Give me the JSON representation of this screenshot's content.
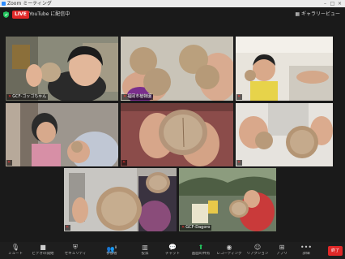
{
  "window": {
    "title": "Zoom ミーティング"
  },
  "topbar": {
    "live_badge": "LIVE",
    "stream_label": "YouTube に配信中",
    "view_label": "ギャラリービュー"
  },
  "participants": [
    {
      "name": "GCF-ゴッゴちゃん",
      "active": true
    },
    {
      "name": "福岡市植物園"
    },
    {
      "name": ""
    },
    {
      "name": ""
    },
    {
      "name": ""
    },
    {
      "name": ""
    },
    {
      "name": ""
    },
    {
      "name": "GCF-Dagoro"
    }
  ],
  "toolbar": {
    "items": [
      {
        "label": "ミュート",
        "icon": "mic-icon"
      },
      {
        "label": "ビデオの開始",
        "icon": "camera-icon"
      },
      {
        "label": "セキュリティ",
        "icon": "shield-icon"
      },
      {
        "label": "参加者",
        "icon": "participants-icon",
        "count": "8"
      },
      {
        "label": "投票",
        "icon": "poll-icon"
      },
      {
        "label": "チャット",
        "icon": "chat-icon"
      },
      {
        "label": "画面の共有",
        "icon": "share-screen-icon"
      },
      {
        "label": "レコーディング",
        "icon": "record-icon"
      },
      {
        "label": "リアクション",
        "icon": "reaction-icon"
      },
      {
        "label": "アプリ",
        "icon": "apps-icon"
      },
      {
        "label": "詳細",
        "icon": "more-icon"
      }
    ],
    "end_label": "終了"
  },
  "colors": {
    "live": "#e02828",
    "share": "#22c55e",
    "active_speaker": "#f5d94a"
  }
}
